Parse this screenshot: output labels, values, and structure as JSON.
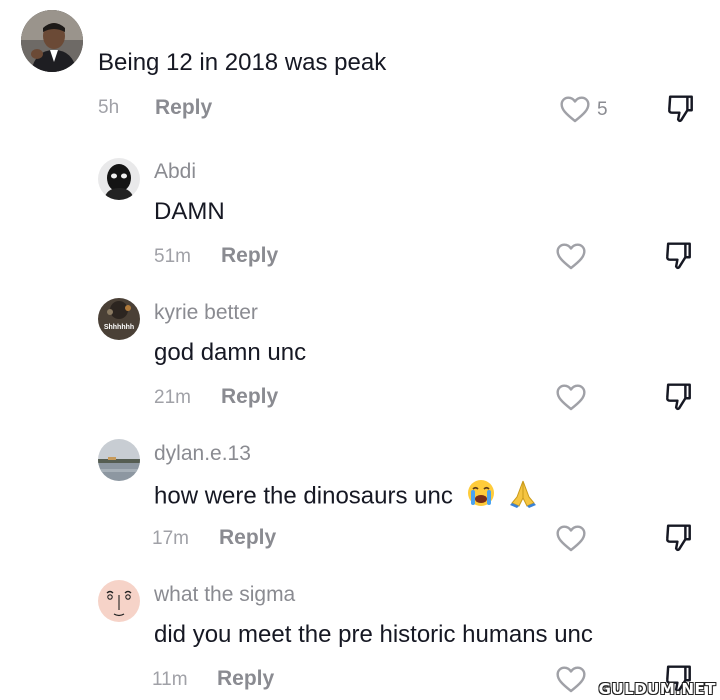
{
  "comments": [
    {
      "text": "Being 12 in 2018 was peak",
      "time": "5h",
      "reply_label": "Reply",
      "likes": "5",
      "avatar_icon": "man-in-suit-avatar"
    },
    {
      "username": "Abdi",
      "text": "DAMN",
      "time": "51m",
      "reply_label": "Reply",
      "avatar_icon": "masked-figure-avatar"
    },
    {
      "username": "kyrie better",
      "text": "god damn unc",
      "time": "21m",
      "reply_label": "Reply",
      "avatar_icon": "shhhhhh-avatar",
      "avatar_text": "Shhhhhh"
    },
    {
      "username": "dylan.e.13",
      "text": "how were the dinosaurs unc",
      "emojis": [
        "loudly-crying-face-emoji",
        "folded-hands-emoji"
      ],
      "time": "17m",
      "reply_label": "Reply",
      "avatar_icon": "lake-landscape-avatar"
    },
    {
      "username": "what the sigma",
      "text": "did you meet the pre historic humans unc",
      "time": "11m",
      "reply_label": "Reply",
      "avatar_icon": "cartoon-face-avatar"
    }
  ],
  "watermark": "GULDUM.NET",
  "colors": {
    "text": "#161823",
    "secondary": "#8a8b91",
    "timestamp": "#a0a1a7"
  }
}
